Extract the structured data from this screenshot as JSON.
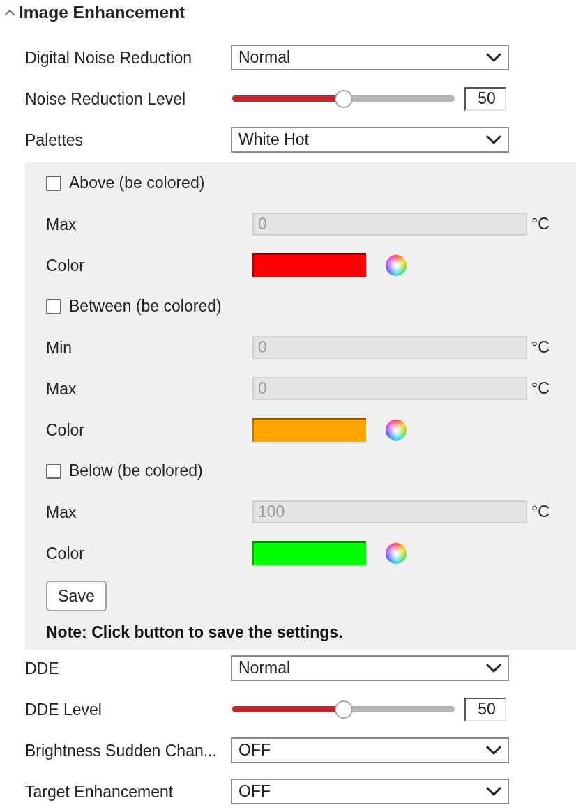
{
  "section": {
    "title": "Image Enhancement",
    "expanded": true
  },
  "settings": [
    {
      "kind": "select",
      "label": "Digital Noise Reduction",
      "value": "Normal"
    },
    {
      "kind": "slider",
      "label": "Noise Reduction Level",
      "level": 0.5,
      "value": "50"
    },
    {
      "kind": "select",
      "label": "Palettes",
      "value": "White Hot"
    }
  ],
  "palette_panel": {
    "rows": [
      {
        "kind": "checkbox",
        "label": "Above (be colored)",
        "checked": false
      },
      {
        "kind": "number",
        "label": "Max",
        "value": "0",
        "unit": "°C",
        "disabled": true
      },
      {
        "kind": "color",
        "label": "Color",
        "color": "#ff0000"
      },
      {
        "kind": "checkbox",
        "label": "Between (be colored)",
        "checked": false
      },
      {
        "kind": "number",
        "label": "Min",
        "value": "0",
        "unit": "°C",
        "disabled": true
      },
      {
        "kind": "number",
        "label": "Max",
        "value": "0",
        "unit": "°C",
        "disabled": true
      },
      {
        "kind": "color",
        "label": "Color",
        "color": "#ffa500"
      },
      {
        "kind": "checkbox",
        "label": "Below (be colored)",
        "checked": false
      },
      {
        "kind": "number",
        "label": "Max",
        "value": "100",
        "unit": "°C",
        "disabled": true
      },
      {
        "kind": "color",
        "label": "Color",
        "color": "#00ff00"
      }
    ],
    "save_button": "Save",
    "note": "Note: Click button to save the settings."
  },
  "settings_more": [
    {
      "kind": "select",
      "label": "DDE",
      "value": "Normal"
    },
    {
      "kind": "slider",
      "label": "DDE Level",
      "level": 0.5,
      "value": "50"
    },
    {
      "kind": "select",
      "label": "Brightness Sudden Chan...",
      "value": "OFF"
    },
    {
      "kind": "select",
      "label": "Target Enhancement",
      "value": "OFF"
    }
  ]
}
